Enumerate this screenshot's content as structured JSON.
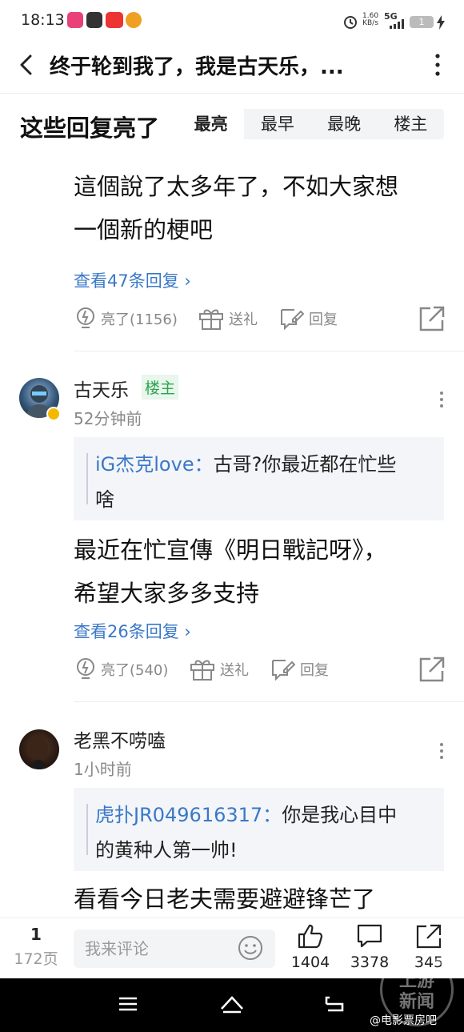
{
  "status": {
    "time": "18:13",
    "net_speed": "1.60",
    "net_unit": "KB/s",
    "network": "5G",
    "battery": "1"
  },
  "nav": {
    "title": "终于轮到我了，我是古天乐，..."
  },
  "section": {
    "heading": "这些回复亮了",
    "tabs": [
      "最亮",
      "最早",
      "最晚",
      "楼主"
    ],
    "active_tab": "最亮"
  },
  "comments": [
    {
      "text_line1": "這個說了太多年了，不如大家想",
      "text_line2": "一個新的梗吧",
      "view_replies": "查看47条回复 ›",
      "like_label": "亮了(1156)",
      "gift_label": "送礼",
      "reply_label": "回复"
    },
    {
      "username": "古天乐",
      "badge": "楼主",
      "time": "52分钟前",
      "quote_name": "iG杰克love：",
      "quote_text_line1": "古哥?你最近都在忙些",
      "quote_text_line2": "啥",
      "text_line1": "最近在忙宣傳《明日戰記呀》，",
      "text_line2": "希望大家多多支持",
      "view_replies": "查看26条回复 ›",
      "like_label": "亮了(540)",
      "gift_label": "送礼",
      "reply_label": "回复"
    },
    {
      "username": "老黑不唠嗑",
      "time": "1小时前",
      "quote_name": "虎扑JR049616317：",
      "quote_text_line1": "你是我心目中",
      "quote_text_line2": "的黄种人第一帅!",
      "text_line1": "看看今日老夫需要避避锋芒了"
    }
  ],
  "bottom": {
    "page_current": "1",
    "page_total": "172页",
    "comment_placeholder": "我来评论",
    "likes": "1404",
    "comments": "3378",
    "shares": "345"
  },
  "watermark": {
    "line1": "上游",
    "line2": "新闻",
    "credit": "@电影票房吧"
  },
  "colors": {
    "link_blue": "#3a78c7",
    "owner_green": "#2ea44f",
    "icon_gray": "#888888"
  }
}
